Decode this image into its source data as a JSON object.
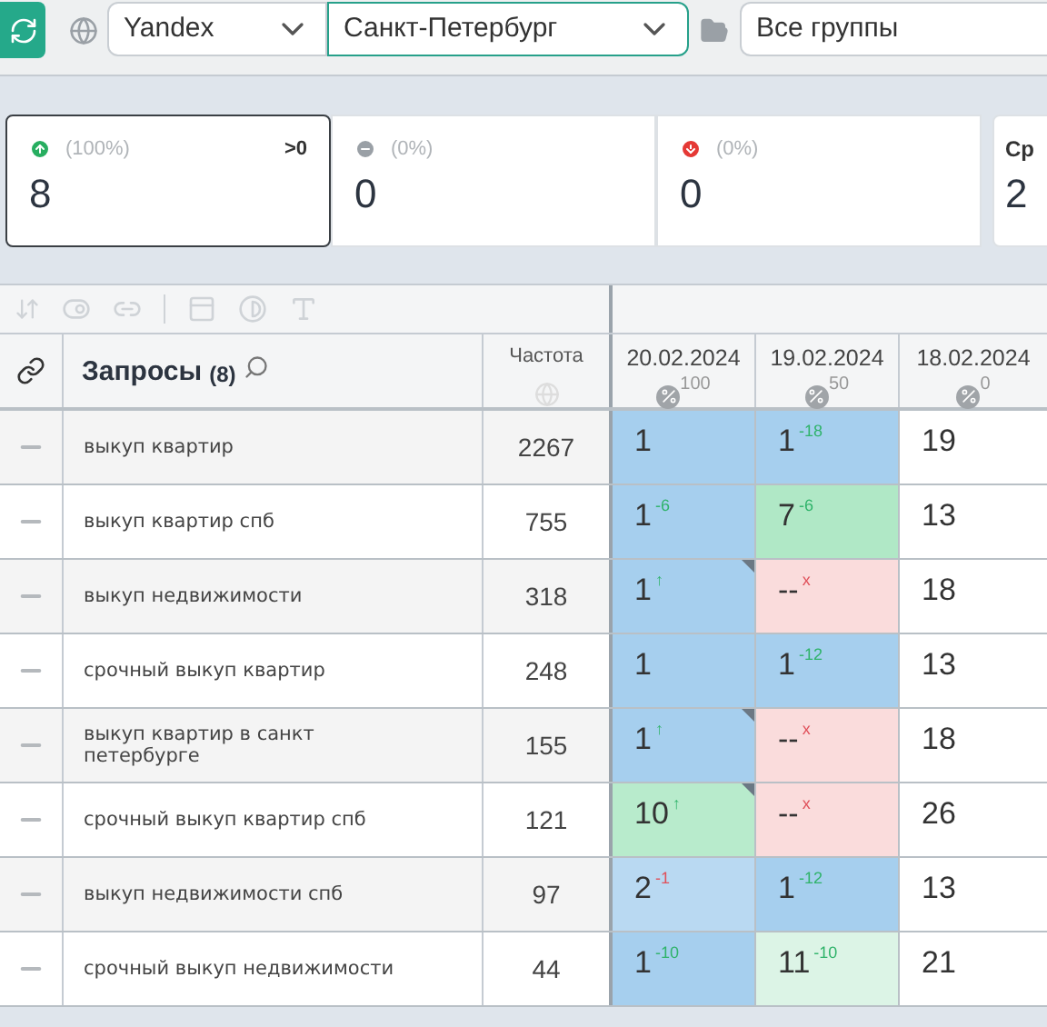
{
  "toolbar": {
    "engine": "Yandex",
    "region": "Санкт-Петербург",
    "group": "Все группы"
  },
  "stats": [
    {
      "kind": "up",
      "percent": "(100%)",
      "badge": ">0",
      "value": "8",
      "selected": true
    },
    {
      "kind": "same",
      "percent": "(0%)",
      "value": "0",
      "selected": false
    },
    {
      "kind": "down",
      "percent": "(0%)",
      "value": "0",
      "selected": false
    },
    {
      "kind": "avg",
      "label": "Ср",
      "value": "2",
      "selected": false
    }
  ],
  "table": {
    "title": "Запросы",
    "count": "(8)",
    "freq_header": "Частота",
    "dates": [
      {
        "date": "20.02.2024",
        "percent": "100"
      },
      {
        "date": "19.02.2024",
        "percent": "50"
      },
      {
        "date": "18.02.2024",
        "percent": "0"
      }
    ],
    "rows": [
      {
        "query": "выкуп квартир",
        "freq": "2267",
        "cells": [
          {
            "value": "1",
            "color": "#a6cfee",
            "flag": false
          },
          {
            "value": "1",
            "delta": "-18",
            "worse": false,
            "color": "#a6cfee",
            "flag": false
          },
          {
            "value": "19",
            "color": "#ffffff",
            "flag": false
          }
        ]
      },
      {
        "query": "выкуп квартир спб",
        "freq": "755",
        "cells": [
          {
            "value": "1",
            "delta": "-6",
            "worse": false,
            "color": "#a6cfee",
            "flag": false
          },
          {
            "value": "7",
            "delta": "-6",
            "worse": false,
            "color": "#b0e8c6",
            "flag": false
          },
          {
            "value": "13",
            "color": "#ffffff",
            "flag": false
          }
        ]
      },
      {
        "query": "выкуп недвижимости",
        "freq": "318",
        "cells": [
          {
            "value": "1",
            "delta": "↑",
            "worse": false,
            "color": "#a6cfee",
            "flag": true
          },
          {
            "value": "--",
            "delta": "x",
            "worse": true,
            "color": "#fadcdc",
            "flag": false
          },
          {
            "value": "18",
            "color": "#ffffff",
            "flag": false
          }
        ]
      },
      {
        "query": "срочный выкуп квартир",
        "freq": "248",
        "cells": [
          {
            "value": "1",
            "color": "#a6cfee",
            "flag": false
          },
          {
            "value": "1",
            "delta": "-12",
            "worse": false,
            "color": "#a6cfee",
            "flag": false
          },
          {
            "value": "13",
            "color": "#ffffff",
            "flag": false
          }
        ]
      },
      {
        "query": "выкуп квартир в санкт петербурге",
        "freq": "155",
        "cells": [
          {
            "value": "1",
            "delta": "↑",
            "worse": false,
            "color": "#a6cfee",
            "flag": true
          },
          {
            "value": "--",
            "delta": "x",
            "worse": true,
            "color": "#fadcdc",
            "flag": false
          },
          {
            "value": "18",
            "color": "#ffffff",
            "flag": false
          }
        ]
      },
      {
        "query": "срочный выкуп квартир спб",
        "freq": "121",
        "cells": [
          {
            "value": "10",
            "delta": "↑",
            "worse": false,
            "color": "#b8ebcc",
            "flag": true
          },
          {
            "value": "--",
            "delta": "x",
            "worse": true,
            "color": "#fadcdc",
            "flag": false
          },
          {
            "value": "26",
            "color": "#ffffff",
            "flag": false
          }
        ]
      },
      {
        "query": "выкуп недвижимости спб",
        "freq": "97",
        "cells": [
          {
            "value": "2",
            "delta": "-1",
            "worse": true,
            "color": "#b9d9f2",
            "flag": false
          },
          {
            "value": "1",
            "delta": "-12",
            "worse": false,
            "color": "#a6cfee",
            "flag": false
          },
          {
            "value": "13",
            "color": "#ffffff",
            "flag": false
          }
        ]
      },
      {
        "query": "срочный выкуп недвижимости",
        "freq": "44",
        "cells": [
          {
            "value": "1",
            "delta": "-10",
            "worse": false,
            "color": "#a6cfee",
            "flag": false
          },
          {
            "value": "11",
            "delta": "-10",
            "worse": false,
            "color": "#dcf4e6",
            "flag": false
          },
          {
            "value": "21",
            "color": "#ffffff",
            "flag": false
          }
        ]
      }
    ]
  }
}
